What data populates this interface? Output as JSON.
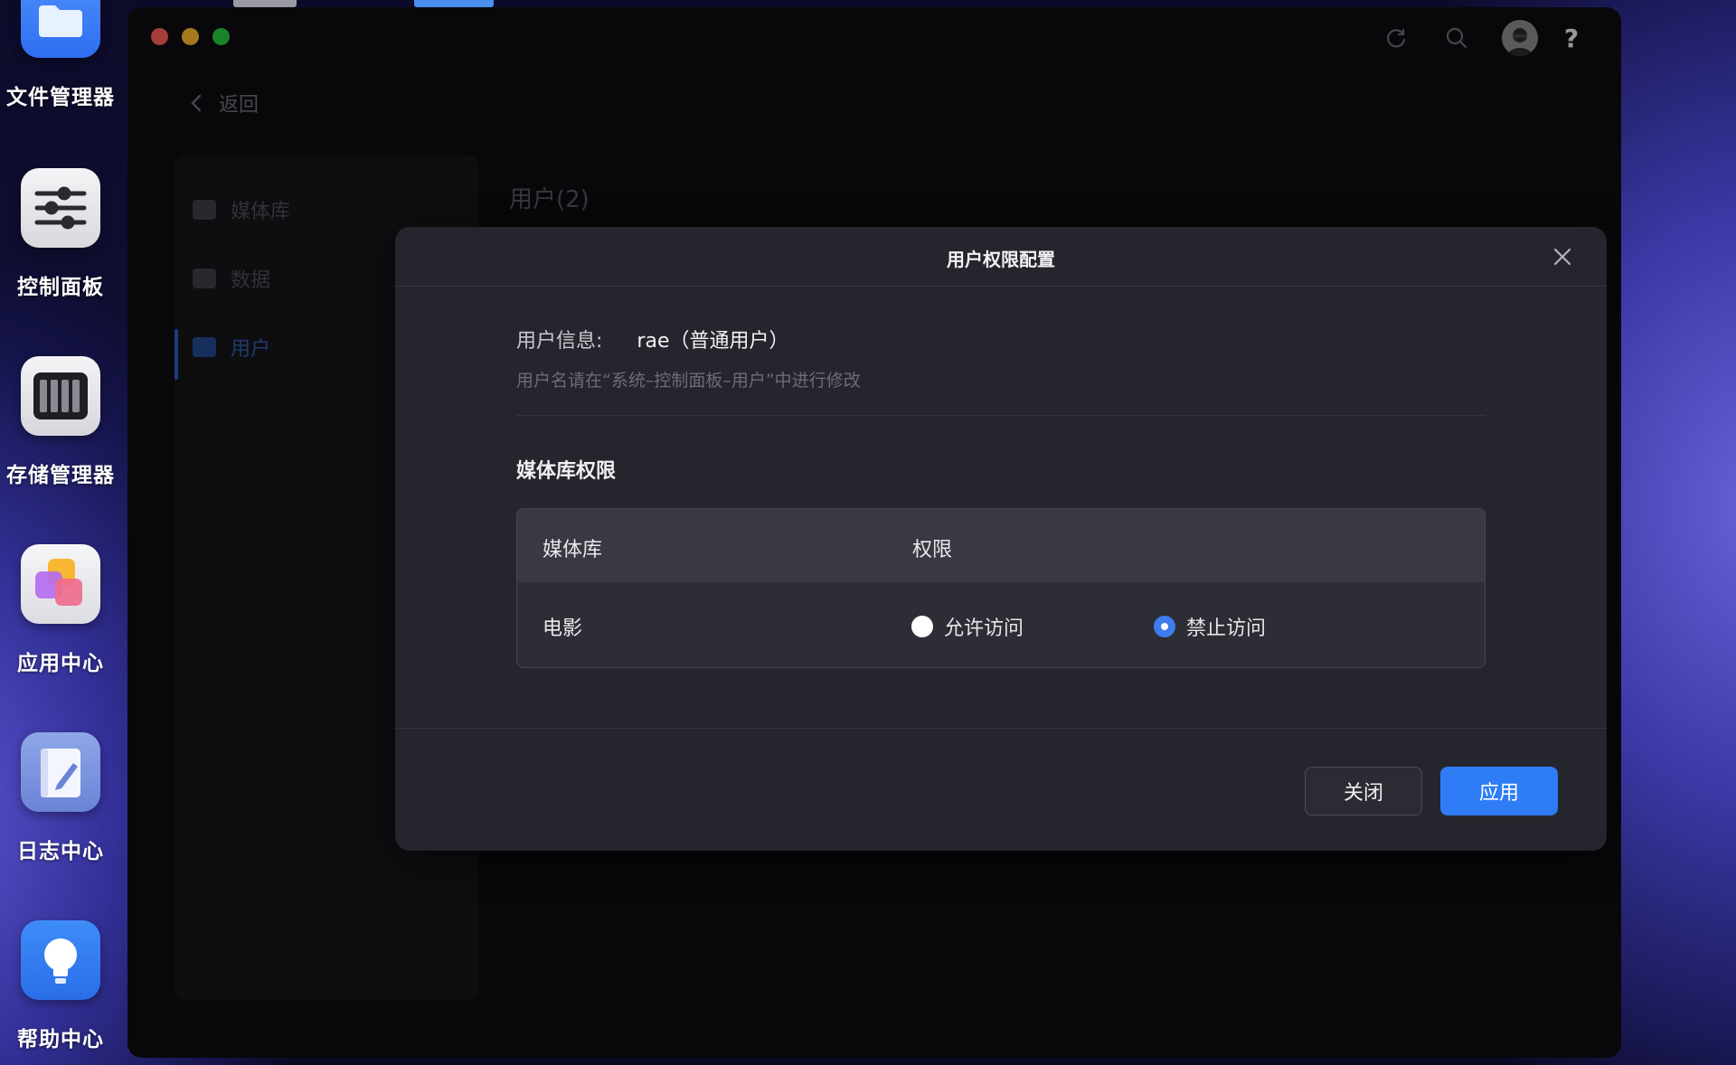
{
  "desktop": {
    "dock": [
      {
        "label": "文件管理器",
        "icon": "folder-icon"
      },
      {
        "label": "控制面板",
        "icon": "sliders-icon"
      },
      {
        "label": "存储管理器",
        "icon": "storage-icon"
      },
      {
        "label": "应用中心",
        "icon": "app-center-icon"
      },
      {
        "label": "日志中心",
        "icon": "log-icon"
      },
      {
        "label": "帮助中心",
        "icon": "lightbulb-icon"
      }
    ]
  },
  "window": {
    "toolbar_icons": [
      "refresh-icon",
      "search-icon",
      "avatar",
      "help-icon"
    ],
    "help_glyph": "?",
    "back_label": "返回",
    "sidebar": {
      "items": [
        {
          "label": "媒体库",
          "icon": "media-library-icon"
        },
        {
          "label": "数据",
          "icon": "chart-icon"
        },
        {
          "label": "用户",
          "icon": "users-icon",
          "active": true
        }
      ]
    },
    "main_title": "用户(2)"
  },
  "modal": {
    "title": "用户权限配置",
    "user_info_label": "用户信息:",
    "user_info_value": "rae（普通用户）",
    "hint": "用户名请在“系统–控制面板–用户”中进行修改",
    "section_title": "媒体库权限",
    "table": {
      "headers": [
        "媒体库",
        "权限"
      ],
      "rows": [
        {
          "library": "电影",
          "options": [
            "允许访问",
            "禁止访问"
          ],
          "selected": "禁止访问"
        }
      ]
    },
    "close_button": "关闭",
    "apply_button": "应用"
  },
  "colors": {
    "accent": "#2e7cf6",
    "radio_checked": "#3d7df0",
    "traffic_red": "#fe5f57",
    "traffic_yellow": "#febc2e",
    "traffic_green": "#28c840"
  }
}
